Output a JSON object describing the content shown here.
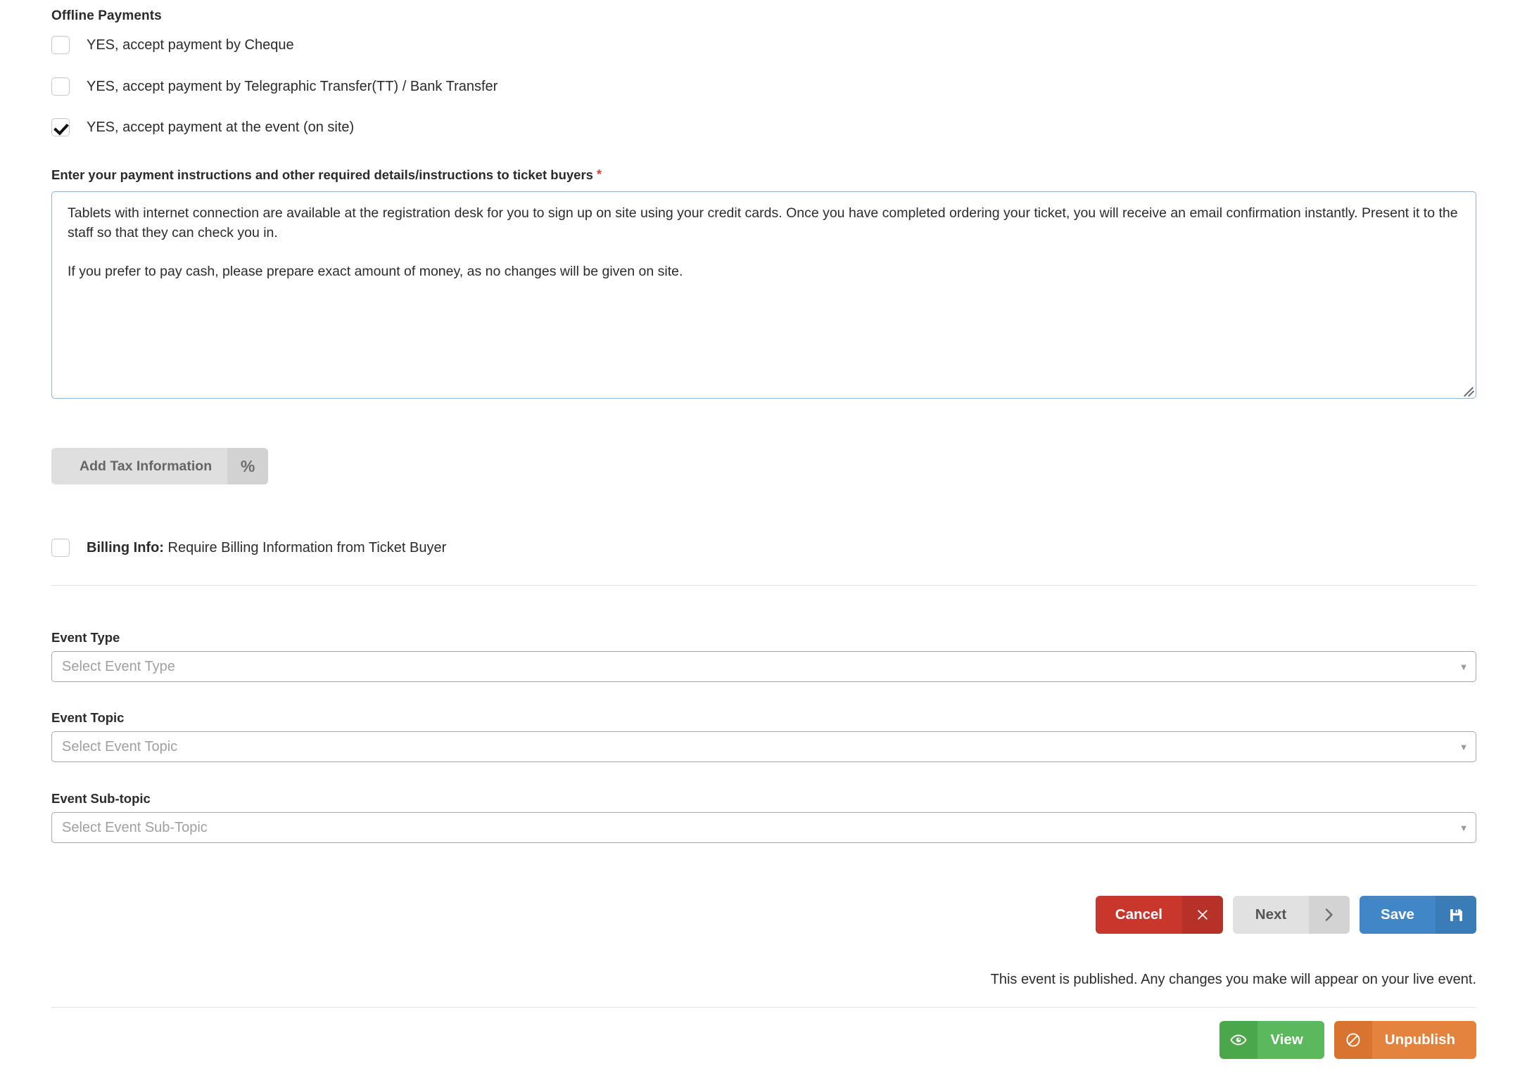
{
  "offline_payments": {
    "heading": "Offline Payments",
    "options": [
      {
        "label": "YES, accept payment by Cheque",
        "checked": false,
        "name": "cheque"
      },
      {
        "label": "YES, accept payment by Telegraphic Transfer(TT) / Bank Transfer",
        "checked": false,
        "name": "telegraphic-transfer"
      },
      {
        "label": "YES, accept payment at the event (on site)",
        "checked": true,
        "name": "on-site"
      }
    ]
  },
  "instructions": {
    "label": "Enter your payment instructions and other required details/instructions to ticket buyers",
    "required_marker": "*",
    "value": "Tablets with internet connection are available at the registration desk for you to sign up on site using your credit cards. Once you have completed ordering your ticket, you will receive an email confirmation instantly. Present it to the staff so that they can check you in.\n\nIf you prefer to pay cash, please prepare exact amount of money, as no changes will be given on site."
  },
  "tax": {
    "button_label": "Add Tax Information",
    "button_icon": "percent-icon",
    "icon_glyph": "%"
  },
  "billing": {
    "label_bold": "Billing Info:",
    "label_rest": " Require Billing Information from Ticket Buyer",
    "checked": false
  },
  "event_fields": [
    {
      "label": "Event Type",
      "placeholder": "Select Event Type",
      "name": "event-type"
    },
    {
      "label": "Event Topic",
      "placeholder": "Select Event Topic",
      "name": "event-topic"
    },
    {
      "label": "Event Sub-topic",
      "placeholder": "Select Event Sub-Topic",
      "name": "event-sub-topic"
    }
  ],
  "actions": {
    "cancel": {
      "label": "Cancel",
      "icon": "close-icon",
      "color": "#c9362c"
    },
    "next": {
      "label": "Next",
      "icon": "chevron-right-icon",
      "color": "#e1e1e1"
    },
    "save": {
      "label": "Save",
      "icon": "floppy-disk-icon",
      "color": "#4087c8"
    }
  },
  "status": {
    "published_note": "This event is published. Any changes you make will appear on your live event."
  },
  "publish_actions": {
    "view": {
      "label": "View",
      "icon": "eye-icon",
      "color": "#5cb85c"
    },
    "unpublish": {
      "label": "Unpublish",
      "icon": "ban-icon",
      "color": "#e3833d"
    }
  },
  "caret_glyph": "▼"
}
